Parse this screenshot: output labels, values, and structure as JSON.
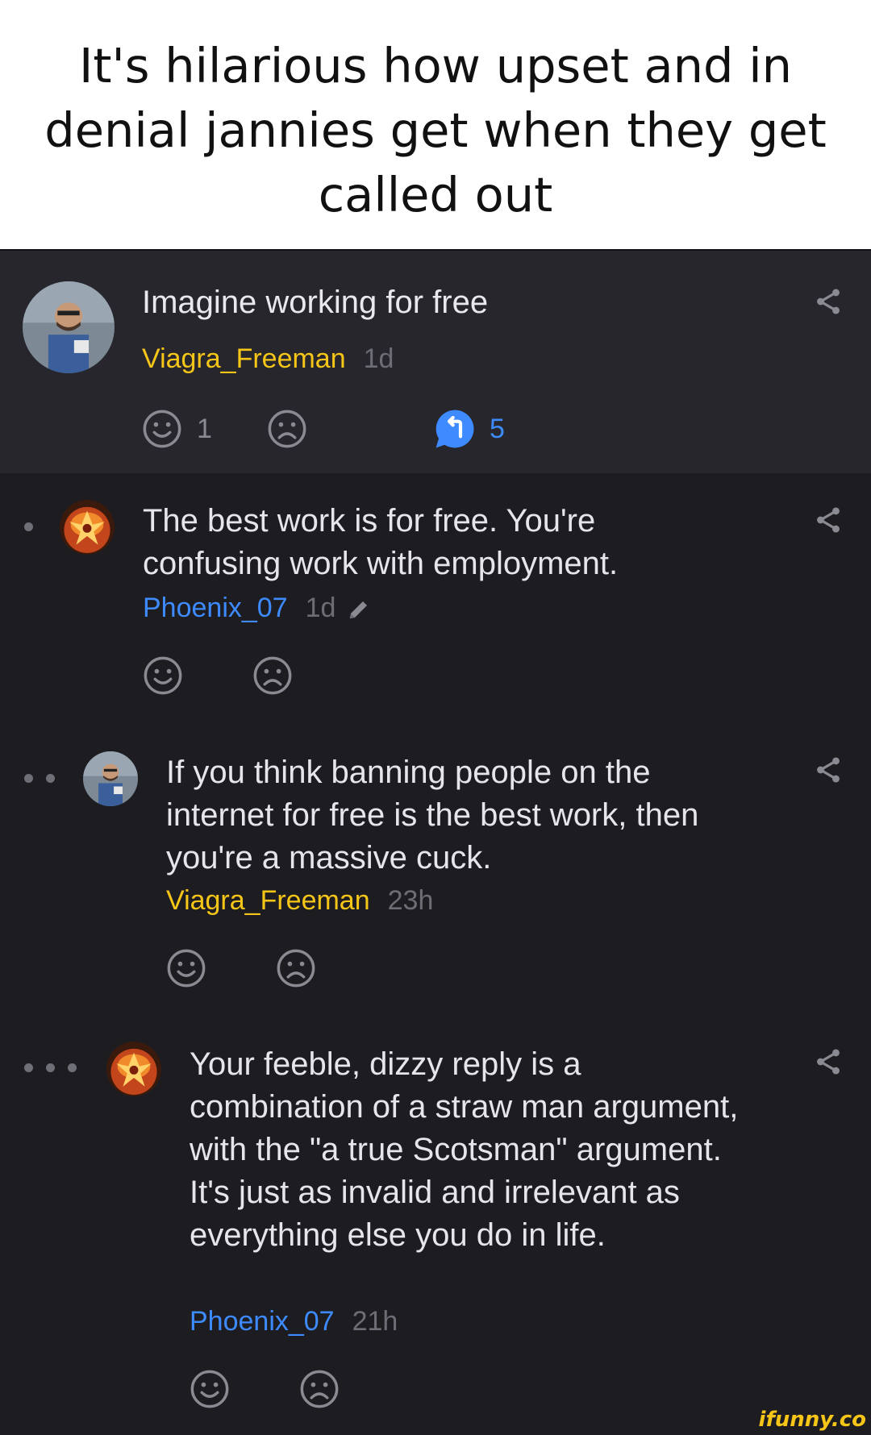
{
  "caption": "It's hilarious how upset and in denial jannies get when they get called out",
  "post": {
    "title": "Imagine working for free",
    "username": "Viagra_Freeman",
    "age": "1d",
    "smile_count": "1",
    "reply_count": "5"
  },
  "comments": [
    {
      "depth": 1,
      "text": "The best work is for free. You're confusing work with employment.",
      "username": "Phoenix_07",
      "age": "1d",
      "edited": true
    },
    {
      "depth": 2,
      "text": "If you think banning people on the internet for free is the best work, then you're a massive cuck.",
      "username": "Viagra_Freeman",
      "age": "23h"
    },
    {
      "depth": 3,
      "text": "Your feeble, dizzy reply is a combination of a straw man argument, with the \"a true Scotsman\" argument. It's just as invalid and irrelevant as everything else you do in life.",
      "username": "Phoenix_07",
      "age": "21h"
    }
  ],
  "icons": {
    "share": "share-icon",
    "smile": "smile-icon",
    "frown": "frown-icon",
    "reply": "reply-icon",
    "edit": "pencil-icon"
  },
  "colors": {
    "username_op": "#f5c518",
    "username_other": "#3d8bff",
    "accent": "#3d8bff",
    "background": "#1c1c21"
  },
  "watermark": "ifunny.co"
}
